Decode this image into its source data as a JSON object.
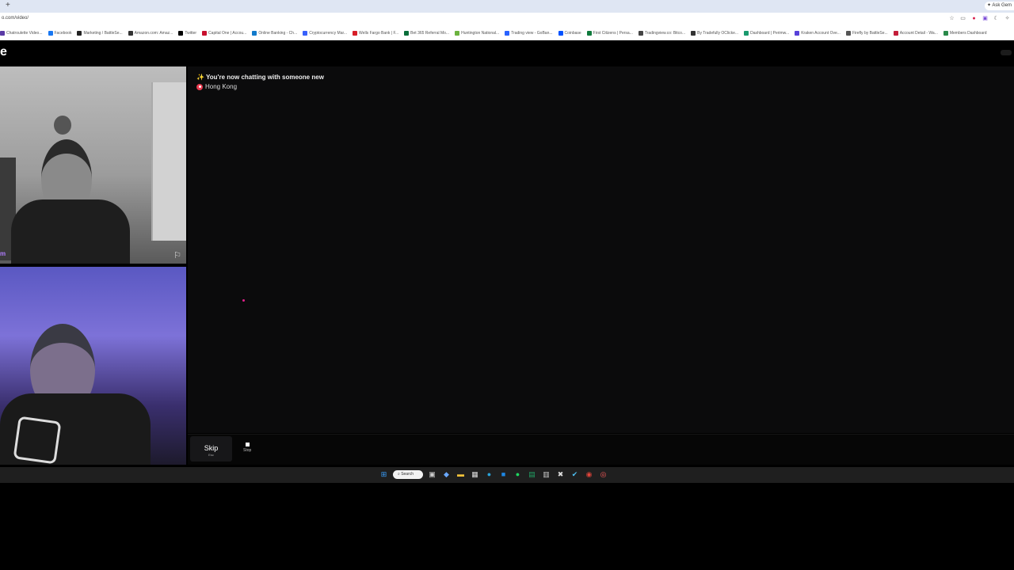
{
  "browser": {
    "new_tab_glyph": "+",
    "ask_label": "✦ Ask Gem",
    "url": "o.com/video/",
    "bookmarks": [
      {
        "label": "Chatroulette Video...",
        "color": "#5a3aa5"
      },
      {
        "label": "Facebook",
        "color": "#1877f2"
      },
      {
        "label": "Marketing / BattleSe...",
        "color": "#222222"
      },
      {
        "label": "Amazon.com: Amaz...",
        "color": "#333333"
      },
      {
        "label": "Twitter",
        "color": "#000000"
      },
      {
        "label": "Capital One | Accou...",
        "color": "#c8102e"
      },
      {
        "label": "Online Banking - Ch...",
        "color": "#117acb"
      },
      {
        "label": "Cryptocurrency Mar...",
        "color": "#3861fb"
      },
      {
        "label": "Wells Fargo Bank | F...",
        "color": "#d71e28"
      },
      {
        "label": "Bet 365 Referral Mo...",
        "color": "#0a6e3a"
      },
      {
        "label": "Huntington National...",
        "color": "#6cb33f"
      },
      {
        "label": "Trading view - GoBan...",
        "color": "#2962ff"
      },
      {
        "label": "Coinbase",
        "color": "#0052ff"
      },
      {
        "label": "First Citizens | Persa...",
        "color": "#0f7a3c"
      },
      {
        "label": "Tradingview.co: Bitco...",
        "color": "#444444"
      },
      {
        "label": "By Tradefully OClicke...",
        "color": "#333333"
      },
      {
        "label": "Dashboard | Perimw...",
        "color": "#1a9a6e"
      },
      {
        "label": "Kraken Account Ove...",
        "color": "#5741d9"
      },
      {
        "label": "Firefly by BattleSe...",
        "color": "#555555"
      },
      {
        "label": "Account Detail - Wa...",
        "color": "#c41e3a"
      },
      {
        "label": "Members Dashboard",
        "color": "#2a8a4a"
      }
    ],
    "toolbar_icons": [
      "star-icon",
      "extension-icon",
      "record-icon",
      "screenshot-icon",
      "moon-icon",
      "puzzle-icon"
    ]
  },
  "app": {
    "logo_text": "e",
    "user_label": "m",
    "chat": {
      "system_message": "✨ You're now chatting with someone new",
      "location": "Hong Kong"
    },
    "controls": {
      "skip_label": "Skip",
      "skip_key": "Esc",
      "stop_label": "Stop"
    }
  },
  "taskbar": {
    "search_label": "Search",
    "icons": [
      {
        "name": "windows-start-icon",
        "glyph": "⊞",
        "color": "#3aa0ff"
      },
      {
        "name": "task-view-icon",
        "glyph": "▣",
        "color": "#cccccc"
      },
      {
        "name": "widget-app-icon",
        "glyph": "◆",
        "color": "#6aa8ff"
      },
      {
        "name": "file-explorer-icon",
        "glyph": "▬",
        "color": "#f3c23a"
      },
      {
        "name": "store-icon",
        "glyph": "▦",
        "color": "#dddddd"
      },
      {
        "name": "edge-icon",
        "glyph": "●",
        "color": "#2aa3d9"
      },
      {
        "name": "app-icon",
        "glyph": "■",
        "color": "#1e88e5"
      },
      {
        "name": "spotify-icon",
        "glyph": "●",
        "color": "#1ed760"
      },
      {
        "name": "sheets-icon",
        "glyph": "▤",
        "color": "#21a366"
      },
      {
        "name": "calculator-icon",
        "glyph": "▥",
        "color": "#cccccc"
      },
      {
        "name": "tools-icon",
        "glyph": "✖",
        "color": "#dddddd"
      },
      {
        "name": "checkmark-app-icon",
        "glyph": "✔",
        "color": "#4fc3f7"
      },
      {
        "name": "chrome-icon",
        "glyph": "◉",
        "color": "#e0443a"
      },
      {
        "name": "obs-icon",
        "glyph": "◎",
        "color": "#ff5c5c"
      }
    ]
  }
}
